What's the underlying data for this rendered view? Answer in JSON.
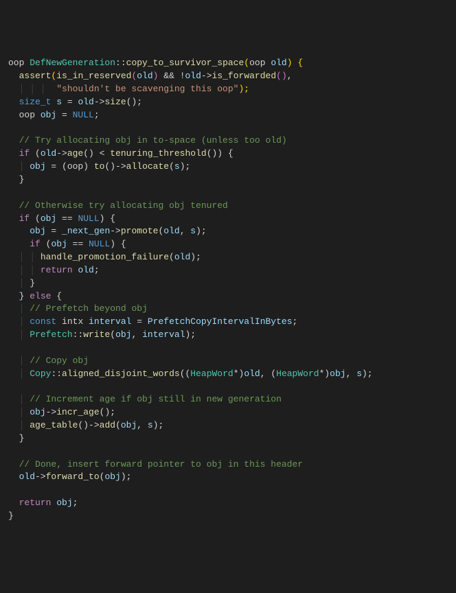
{
  "code": {
    "l1": {
      "t1": "oop ",
      "t2": "DefNewGeneration",
      "t3": "::",
      "t4": "copy_to_survivor_space",
      "t5": "(",
      "t6": "oop ",
      "t7": "old",
      "t8": ") {"
    },
    "l2": {
      "t1": "  ",
      "t2": "assert",
      "t3": "(",
      "t4": "is_in_reserved",
      "t5": "(",
      "t6": "old",
      "t7": ")",
      "t8": " && !",
      "t9": "old",
      "t10": "->",
      "t11": "is_forwarded",
      "t12": "()",
      "t13": ","
    },
    "l3": {
      "t1": "         ",
      "t2": "\"shouldn't be scavenging this oop\"",
      "t3": ");"
    },
    "l4": {
      "t1": "  ",
      "t2": "size_t",
      "t3": " ",
      "t4": "s",
      "t5": " = ",
      "t6": "old",
      "t7": "->",
      "t8": "size",
      "t9": "();"
    },
    "l5": {
      "t1": "  oop ",
      "t2": "obj",
      "t3": " = ",
      "t4": "NULL",
      "t5": ";"
    },
    "l6": {
      "t1": ""
    },
    "l7": {
      "t1": "  ",
      "t2": "// Try allocating obj in to-space (unless too old)"
    },
    "l8": {
      "t1": "  ",
      "t2": "if",
      "t3": " (",
      "t4": "old",
      "t5": "->",
      "t6": "age",
      "t7": "() < ",
      "t8": "tenuring_threshold",
      "t9": "()) {"
    },
    "l9": {
      "t1": "    ",
      "t2": "obj",
      "t3": " = (oop) ",
      "t4": "to",
      "t5": "()->",
      "t6": "allocate",
      "t7": "(",
      "t8": "s",
      "t9": ");"
    },
    "l10": {
      "t1": "  }"
    },
    "l11": {
      "t1": ""
    },
    "l12": {
      "t1": "  ",
      "t2": "// Otherwise try allocating obj tenured"
    },
    "l13": {
      "t1": "  ",
      "t2": "if",
      "t3": " (",
      "t4": "obj",
      "t5": " == ",
      "t6": "NULL",
      "t7": ") {"
    },
    "l14": {
      "t1": "    ",
      "t2": "obj",
      "t3": " = ",
      "t4": "_next_gen",
      "t5": "->",
      "t6": "promote",
      "t7": "(",
      "t8": "old",
      "t9": ", ",
      "t10": "s",
      "t11": ");"
    },
    "l15": {
      "t1": "    ",
      "t2": "if",
      "t3": " (",
      "t4": "obj",
      "t5": " == ",
      "t6": "NULL",
      "t7": ") {"
    },
    "l16": {
      "t1": "      ",
      "t2": "handle_promotion_failure",
      "t3": "(",
      "t4": "old",
      "t5": ");"
    },
    "l17": {
      "t1": "      ",
      "t2": "return",
      "t3": " ",
      "t4": "old",
      "t5": ";"
    },
    "l18": {
      "t1": "    }"
    },
    "l19": {
      "t1": "  } ",
      "t2": "else",
      "t3": " {"
    },
    "l20": {
      "t1": "    ",
      "t2": "// Prefetch beyond obj"
    },
    "l21": {
      "t1": "    ",
      "t2": "const",
      "t3": " intx ",
      "t4": "interval",
      "t5": " = ",
      "t6": "PrefetchCopyIntervalInBytes",
      "t7": ";"
    },
    "l22": {
      "t1": "    ",
      "t2": "Prefetch",
      "t3": "::",
      "t4": "write",
      "t5": "(",
      "t6": "obj",
      "t7": ", ",
      "t8": "interval",
      "t9": ");"
    },
    "l23": {
      "t1": ""
    },
    "l24": {
      "t1": "    ",
      "t2": "// Copy obj"
    },
    "l25": {
      "t1": "    ",
      "t2": "Copy",
      "t3": "::",
      "t4": "aligned_disjoint_words",
      "t5": "((",
      "t6": "HeapWord",
      "t7": "*)",
      "t8": "old",
      "t9": ", (",
      "t10": "HeapWord",
      "t11": "*)",
      "t12": "obj",
      "t13": ", ",
      "t14": "s",
      "t15": ");"
    },
    "l26": {
      "t1": ""
    },
    "l27": {
      "t1": "    ",
      "t2": "// Increment age if obj still in new generation"
    },
    "l28": {
      "t1": "    ",
      "t2": "obj",
      "t3": "->",
      "t4": "incr_age",
      "t5": "();"
    },
    "l29": {
      "t1": "    ",
      "t2": "age_table",
      "t3": "()->",
      "t4": "add",
      "t5": "(",
      "t6": "obj",
      "t7": ", ",
      "t8": "s",
      "t9": ");"
    },
    "l30": {
      "t1": "  }"
    },
    "l31": {
      "t1": ""
    },
    "l32": {
      "t1": "  ",
      "t2": "// Done, insert forward pointer to obj in this header"
    },
    "l33": {
      "t1": "  ",
      "t2": "old",
      "t3": "->",
      "t4": "forward_to",
      "t5": "(",
      "t6": "obj",
      "t7": ");"
    },
    "l34": {
      "t1": ""
    },
    "l35": {
      "t1": "  ",
      "t2": "return",
      "t3": " ",
      "t4": "obj",
      "t5": ";"
    },
    "l36": {
      "t1": "}"
    }
  }
}
